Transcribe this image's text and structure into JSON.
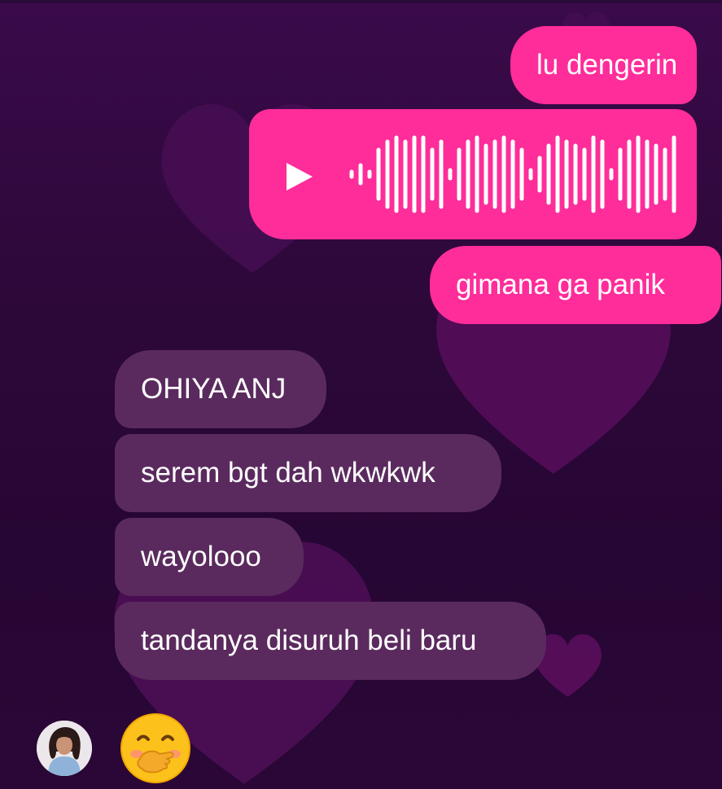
{
  "messages": {
    "outgoing_1": "lu dengerin",
    "outgoing_2": "gimana ga panik",
    "incoming_1": "OHIYA ANJ",
    "incoming_2": "serem bgt dah wkwkwk",
    "incoming_3": "wayolooo",
    "incoming_4": "tandanya disuruh beli baru"
  },
  "voice_message": {
    "icon": "play-icon",
    "waveform_icon": "waveform-icon"
  },
  "reaction": {
    "emoji": "hand-over-mouth-emoji"
  },
  "colors": {
    "outgoing_bubble": "#fe2d9a",
    "incoming_bubble": "#5a2a5e",
    "background": "#2a0839",
    "text": "#ffffff"
  }
}
